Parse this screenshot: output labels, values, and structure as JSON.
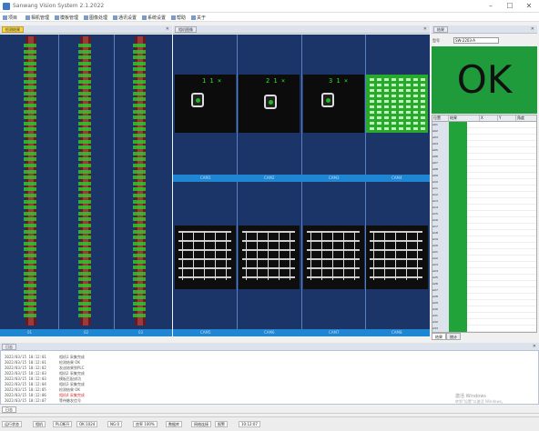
{
  "window": {
    "title": "Sanwang Vision System 2.1.2022"
  },
  "menu": [
    "项目",
    "相机管理",
    "模板管理",
    "图像处理",
    "通讯设置",
    "系统设置",
    "帮助",
    "关于"
  ],
  "left_panel": {
    "tab": "检测结果",
    "strip_labels": [
      "01",
      "02",
      "03"
    ]
  },
  "camera_panel": {
    "tab": "相机图像",
    "top_labels": [
      "1 1 ×",
      "2 1 ×",
      "3 1 ×",
      "4 1 ×"
    ],
    "top_strip_labels": [
      "CAM1",
      "CAM2",
      "CAM3",
      "CAM4"
    ],
    "bottom_strip_labels": [
      "CAM5",
      "CAM6",
      "CAM7",
      "CAM8"
    ]
  },
  "result_panel": {
    "tab": "结果",
    "info_label": "型号",
    "info_value": "SW-2203-A",
    "result": "OK",
    "table_headers": [
      "位置",
      "结果",
      "X",
      "Y",
      "角度"
    ],
    "rows": [
      "A01",
      "A02",
      "A03",
      "A04",
      "A05",
      "A06",
      "A07",
      "A08",
      "A09",
      "A10",
      "A11",
      "A12",
      "A13",
      "A14",
      "A15",
      "A16",
      "A17",
      "A18",
      "A19",
      "A20",
      "A21",
      "A22",
      "A23",
      "A24",
      "A25",
      "A26",
      "A27",
      "A28",
      "A29",
      "A30",
      "A31",
      "A32",
      "A33"
    ],
    "tabs": [
      "结果",
      "统计"
    ]
  },
  "log_panel": {
    "tab": "日志",
    "lines": [
      {
        "time": "2022/03/15 10:12:01",
        "msg": "相机1 采集完成",
        "color": "#555555"
      },
      {
        "time": "2022/03/15 10:12:01",
        "msg": "检测结果 OK",
        "color": "#555555"
      },
      {
        "time": "2022/03/15 10:12:02",
        "msg": "发送结果到PLC",
        "color": "#555555"
      },
      {
        "time": "2022/03/15 10:12:03",
        "msg": "相机2 采集完成",
        "color": "#555555"
      },
      {
        "time": "2022/03/15 10:12:03",
        "msg": "模板匹配成功",
        "color": "#555555"
      },
      {
        "time": "2022/03/15 10:12:04",
        "msg": "相机3 采集完成",
        "color": "#555555"
      },
      {
        "time": "2022/03/15 10:12:05",
        "msg": "检测结果 OK",
        "color": "#555555"
      },
      {
        "time": "2022/03/15 10:12:06",
        "msg": "相机4 采集完成",
        "color": "#d62c2c"
      },
      {
        "time": "2022/03/15 10:12:07",
        "msg": "等待触发信号",
        "color": "#555555"
      }
    ],
    "bottom_tab": "日志"
  },
  "watermark": {
    "line1": "激活 Windows",
    "line2": "转到\"设置\"以激活 Windows。"
  },
  "status": [
    "运行状态",
    "相机",
    "PLC断开",
    "OK:1024",
    "NG:0",
    "良率 100%",
    "数据库",
    "网络连接",
    "报警",
    "10:12:07"
  ]
}
